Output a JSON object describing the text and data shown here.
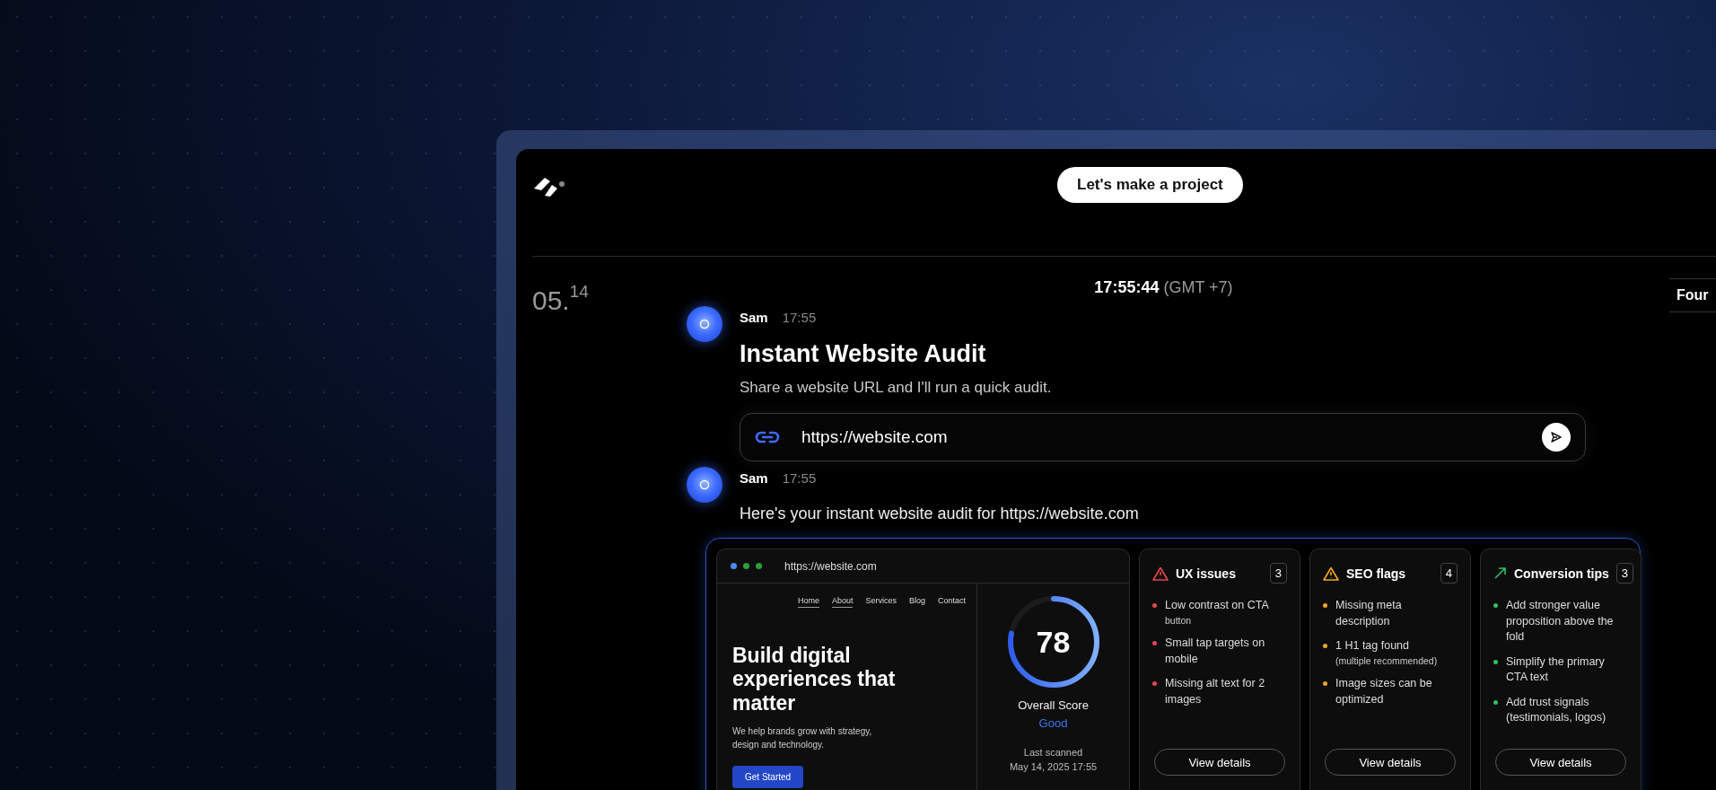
{
  "header": {
    "project_button": "Let's make a project"
  },
  "date": {
    "day": "05.",
    "superscript": "14"
  },
  "clock": {
    "time": "17:55:44",
    "zone": "(GMT +7)"
  },
  "side_tab": "Four",
  "messages": [
    {
      "kind": "prompt",
      "author": "Sam",
      "time": "17:55",
      "title": "Instant Website Audit",
      "text": "Share a website URL and I'll run a quick audit.",
      "input_value": "https://website.com"
    },
    {
      "kind": "audit",
      "author": "Sam",
      "time": "17:55",
      "text": "Here's your instant website audit for https://website.com"
    }
  ],
  "audit": {
    "browser": {
      "dots": [
        {
          "color": "#4a8af0"
        },
        {
          "color": "#2e9e3a"
        },
        {
          "color": "#2e9e3a"
        }
      ],
      "url": "https://website.com"
    },
    "nav": [
      {
        "label": "Home",
        "selected": true
      },
      {
        "label": "About",
        "selected": true
      },
      {
        "label": "Services",
        "selected": false
      },
      {
        "label": "Blog",
        "selected": false
      },
      {
        "label": "Contact",
        "selected": false
      }
    ],
    "hero_title": "Build digital experiences that matter",
    "hero_text": "We help brands grow with strategy, design and technology.",
    "hero_button": "Get Started",
    "score": {
      "value": "78",
      "level": 0.78,
      "label": "Overall Score",
      "rating": "Good",
      "scanned_label": "Last scanned",
      "scanned_date": "May 14, 2025 17:55"
    },
    "cards": [
      {
        "kind": "warning",
        "color": "#e5484d",
        "title": "UX issues",
        "count": "3",
        "items": [
          {
            "text": "Low contrast on CTA",
            "note": "button"
          },
          {
            "text": "Small tap targets on mobile"
          },
          {
            "text": "Missing alt text for 2 images"
          }
        ],
        "button": "View details"
      },
      {
        "kind": "warning",
        "color": "#f5a623",
        "title": "SEO flags",
        "count": "4",
        "items": [
          {
            "text": "Missing meta description"
          },
          {
            "text": "1 H1 tag found",
            "note": "(multiple recommended)"
          },
          {
            "text": "Image sizes can be optimized"
          }
        ],
        "button": "View details"
      },
      {
        "kind": "trend",
        "color": "#30c060",
        "title": "Conversion tips",
        "count": "3",
        "items": [
          {
            "text": "Add stronger value proposition above the fold"
          },
          {
            "text": "Simplify the primary CTA text"
          },
          {
            "text": "Add trust signals (testimonials, logos)"
          }
        ],
        "button": "View details"
      }
    ]
  }
}
